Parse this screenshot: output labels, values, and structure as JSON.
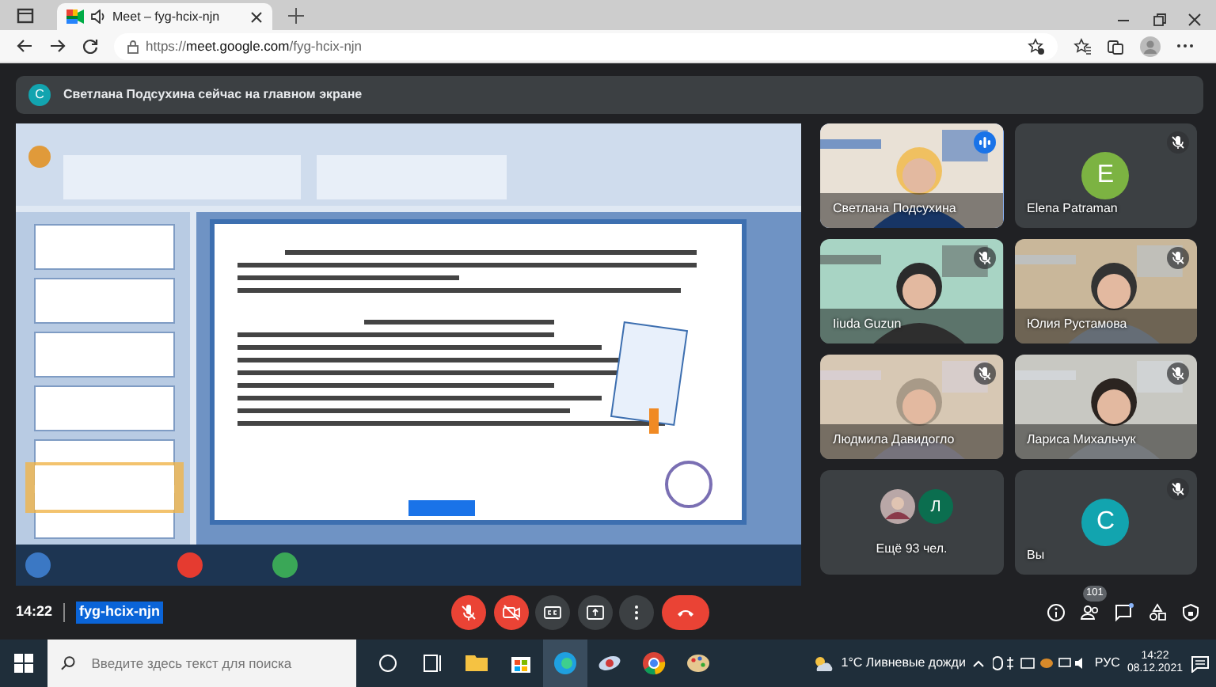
{
  "browser": {
    "tab_title": "Meet – fyg-hcix-njn",
    "url_scheme": "https://",
    "url_host": "meet.google.com",
    "url_path": "/fyg-hcix-njn"
  },
  "banner": {
    "letter": "С",
    "text": "Светлана Подсухина сейчас на главном экране"
  },
  "participants": [
    {
      "kind": "video",
      "name": "Светлана Подсухина",
      "muted": false,
      "speaking": true
    },
    {
      "kind": "avatar",
      "name": "Elena Patraman",
      "letter": "E",
      "color": "#7cb342",
      "muted": true,
      "speaking": false
    },
    {
      "kind": "video",
      "name": "Iiuda Guzun",
      "muted": true,
      "speaking": false
    },
    {
      "kind": "video",
      "name": "Юлия Рустамова",
      "muted": true,
      "speaking": false
    },
    {
      "kind": "video",
      "name": "Людмила Давидогло",
      "muted": true,
      "speaking": false
    },
    {
      "kind": "video",
      "name": "Лариса Михальчук",
      "muted": true,
      "speaking": false
    },
    {
      "kind": "more",
      "name": "Ещё 93 чел.",
      "letter": "Л",
      "color": "#0b6e4f",
      "muted": false,
      "speaking": false
    },
    {
      "kind": "avatar",
      "name": "Вы",
      "letter": "С",
      "color": "#12a4af",
      "muted": true,
      "speaking": false
    }
  ],
  "meeting": {
    "time": "14:22",
    "code": "fyg-hcix-njn",
    "code_selected": true,
    "mic_on": false,
    "camera_on": false,
    "people_count": "101"
  },
  "taskbar": {
    "search_placeholder": "Введите здесь текст для поиска",
    "weather": "1°C  Ливневые дожди",
    "language": "РУС",
    "time": "14:22",
    "date": "08.12.2021"
  }
}
